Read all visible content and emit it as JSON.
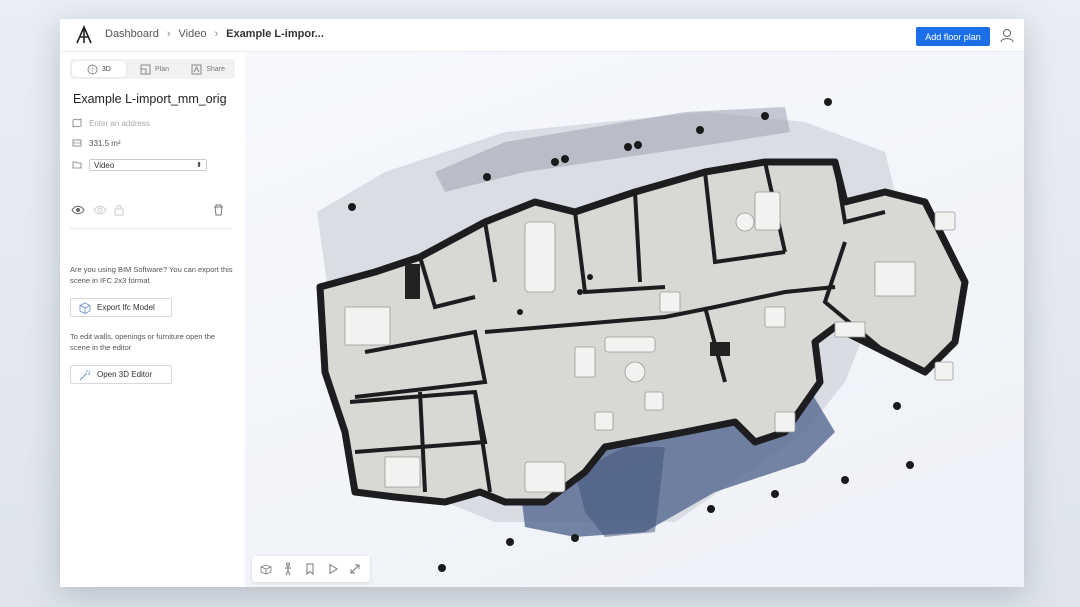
{
  "breadcrumb": {
    "items": [
      "Dashboard",
      "Video",
      "Example L-impor..."
    ]
  },
  "topbar": {
    "add_button_label": "Add floor plan"
  },
  "sidebar": {
    "tabs": [
      {
        "label": "3D",
        "icon": "cube-icon",
        "active": true
      },
      {
        "label": "Plan",
        "icon": "plan-icon",
        "active": false
      },
      {
        "label": "Share",
        "icon": "share-icon",
        "active": false
      }
    ],
    "scene_name": "Example L-import_mm_orig",
    "address_placeholder": "Enter an address",
    "area": "331.5 m²",
    "folder_value": "Video",
    "bim_text": "Are you using BIM Software? You can export this scene in IFC 2x3 format",
    "export_label": "Export Ifc Model",
    "editor_text": "To edit walls, openings or furniture open the scene in the editor",
    "editor_label": "Open 3D Editor"
  },
  "colors": {
    "accent": "#1a6ee8",
    "wall": "#222222",
    "floor": "#d9dcd6"
  }
}
